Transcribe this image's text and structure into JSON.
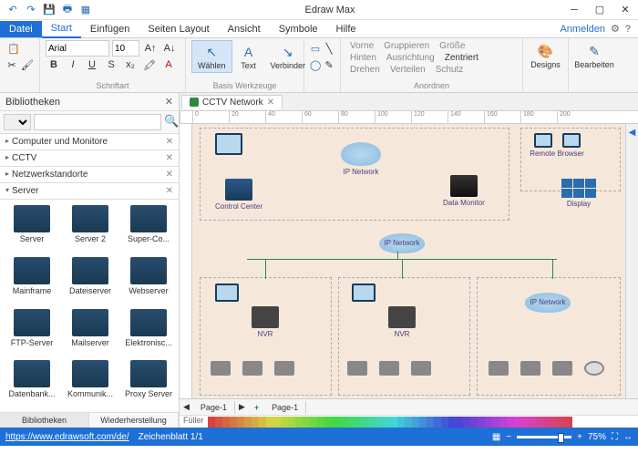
{
  "app": {
    "title": "Edraw Max"
  },
  "qat": [
    "↶",
    "↷",
    "💾",
    "🖶",
    "▦"
  ],
  "menu": {
    "file": "Datei",
    "items": [
      "Start",
      "Einfügen",
      "Seiten Layout",
      "Ansicht",
      "Symbole",
      "Hilfe"
    ],
    "active": "Start",
    "login": "Anmelden"
  },
  "ribbon": {
    "font_name": "Arial",
    "font_size": "10",
    "group_font": "Schriftart",
    "tools": {
      "select": "Wählen",
      "text": "Text",
      "connector": "Verbinder",
      "group_label": "Basis Werkzeuge"
    },
    "arrange": {
      "front": "Vorne",
      "group": "Gruppieren",
      "size": "Größe",
      "back": "Hinten",
      "align": "Ausrichtung",
      "center": "Zentriert",
      "rotate": "Drehen",
      "distrib": "Verteilen",
      "protect": "Schutz",
      "label": "Anordnen"
    },
    "designs": "Designs",
    "edit": "Bearbeiten"
  },
  "lib": {
    "title": "Bibliotheken",
    "search_ph": "",
    "cats": [
      "Computer und Monitore",
      "CCTV",
      "Netzwerkstandorte",
      "Server"
    ],
    "items": [
      "Server",
      "Server 2",
      "Super-Co...",
      "Mainframe",
      "Dateiserver",
      "Webserver",
      "FTP-Server",
      "Mailserver",
      "Elektronisc...",
      "Datenbank...",
      "Kommunik...",
      "Proxy Server"
    ],
    "tabs": [
      "Bibliotheken",
      "Wiederherstellung"
    ]
  },
  "doc": {
    "tab": "CCTV Network"
  },
  "ruler": [
    "0",
    "20",
    "40",
    "60",
    "80",
    "100",
    "120",
    "140",
    "160",
    "180",
    "200"
  ],
  "canvas": {
    "control_center": "Control Center",
    "ip_network": "IP Network",
    "data_monitor": "Data Monitor",
    "remote_browser": "Remote Browser",
    "display": "Display",
    "nvr": "NVR"
  },
  "pages": {
    "p1": "Page-1",
    "p2": "Page-1",
    "add": "+"
  },
  "colorbar": {
    "label": "Füller"
  },
  "status": {
    "url": "https://www.edrawsoft.com/de/",
    "sheet": "Zeichenblatt 1/1",
    "zoom": "75%"
  }
}
